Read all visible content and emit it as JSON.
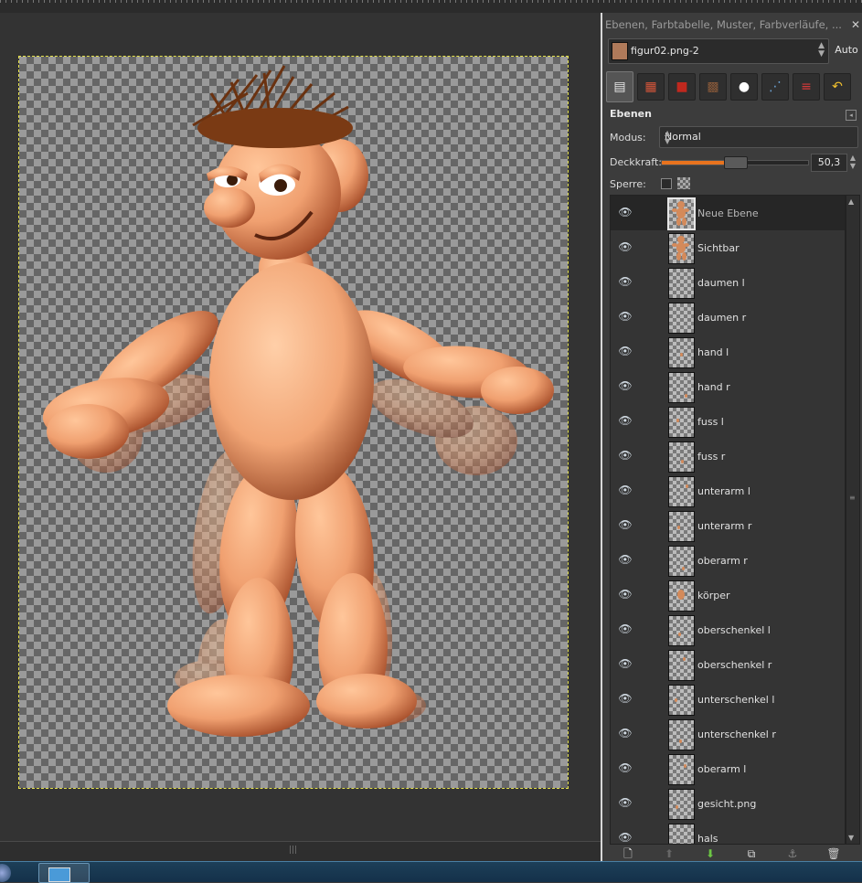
{
  "dock": {
    "title": "Ebenen, Farbtabelle, Muster, Farbverläufe, ...",
    "image_name": "figur02.png-2",
    "auto_label": "Auto"
  },
  "layers_panel": {
    "title": "Ebenen",
    "mode_label": "Modus:",
    "mode_value": "Normal",
    "opacity_label": "Deckkraft:",
    "opacity_value": "50,3",
    "opacity_percent": 50.3,
    "lock_label": "Sperre:"
  },
  "tabs": [
    {
      "name": "layers-tab-icon",
      "glyph": "▤",
      "color": "#e8e8e8"
    },
    {
      "name": "palette-tab-icon",
      "glyph": "▦",
      "color": "#d4553a"
    },
    {
      "name": "brushes-tab-icon",
      "glyph": "■",
      "color": "#c0281e"
    },
    {
      "name": "patterns-tab-icon",
      "glyph": "▩",
      "color": "#8a5a3a"
    },
    {
      "name": "gradients-tab-icon",
      "glyph": "●",
      "color": "#ffffff"
    },
    {
      "name": "paths-tab-icon",
      "glyph": "⋰",
      "color": "#6fa8dc"
    },
    {
      "name": "channels-tab-icon",
      "glyph": "≡",
      "color": "#d63a3a"
    },
    {
      "name": "undo-history-tab-icon",
      "glyph": "↶",
      "color": "#f2c12e"
    }
  ],
  "layers": [
    {
      "name": "Neue Ebene",
      "selected": true,
      "thumb": "figure"
    },
    {
      "name": "Sichtbar",
      "selected": false,
      "thumb": "figure"
    },
    {
      "name": "daumen l",
      "selected": false,
      "thumb": "empty"
    },
    {
      "name": "daumen r",
      "selected": false,
      "thumb": "empty"
    },
    {
      "name": "hand l",
      "selected": false,
      "thumb": "dot"
    },
    {
      "name": "hand r",
      "selected": false,
      "thumb": "dot"
    },
    {
      "name": "fuss l",
      "selected": false,
      "thumb": "dot"
    },
    {
      "name": "fuss r",
      "selected": false,
      "thumb": "dot"
    },
    {
      "name": "unterarm l",
      "selected": false,
      "thumb": "dot"
    },
    {
      "name": "unterarm r",
      "selected": false,
      "thumb": "dot"
    },
    {
      "name": "oberarm r",
      "selected": false,
      "thumb": "dot"
    },
    {
      "name": "körper",
      "selected": false,
      "thumb": "body"
    },
    {
      "name": "oberschenkel l",
      "selected": false,
      "thumb": "dot"
    },
    {
      "name": "oberschenkel r",
      "selected": false,
      "thumb": "dot"
    },
    {
      "name": "unterschenkel l",
      "selected": false,
      "thumb": "dot"
    },
    {
      "name": "unterschenkel r",
      "selected": false,
      "thumb": "dot"
    },
    {
      "name": "oberarm l",
      "selected": false,
      "thumb": "dot"
    },
    {
      "name": "gesicht.png",
      "selected": false,
      "thumb": "dot"
    },
    {
      "name": "hals",
      "selected": false,
      "thumb": "empty"
    }
  ],
  "footer_buttons": [
    {
      "name": "new-layer-icon",
      "glyph": "🗋",
      "color": "#eeeeee"
    },
    {
      "name": "raise-layer-icon",
      "glyph": "⬆",
      "color": "#666666"
    },
    {
      "name": "lower-layer-icon",
      "glyph": "⬇",
      "color": "#6cc644"
    },
    {
      "name": "duplicate-layer-icon",
      "glyph": "⧉",
      "color": "#dddddd"
    },
    {
      "name": "anchor-layer-icon",
      "glyph": "⚓",
      "color": "#888888"
    },
    {
      "name": "delete-layer-icon",
      "glyph": "🗑",
      "color": "#cccccc"
    }
  ],
  "colors": {
    "accent": "#e8731e",
    "skin": "#f0a070",
    "hair": "#6b3210"
  }
}
